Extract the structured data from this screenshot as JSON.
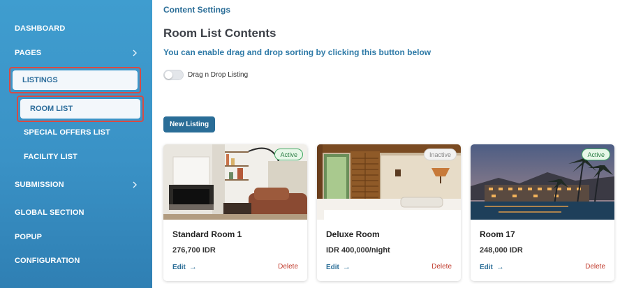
{
  "sidebar": {
    "items": [
      {
        "label": "DASHBOARD"
      },
      {
        "label": "PAGES"
      },
      {
        "label": "LISTINGS"
      },
      {
        "label": "ROOM LIST"
      },
      {
        "label": "SPECIAL OFFERS LIST"
      },
      {
        "label": "FACILITY LIST"
      },
      {
        "label": "SUBMISSION"
      },
      {
        "label": "GLOBAL SECTION"
      },
      {
        "label": "POPUP"
      },
      {
        "label": "CONFIGURATION"
      }
    ],
    "colors": {
      "background": "#3a92c6",
      "highlight_border": "#d64b45"
    }
  },
  "main": {
    "breadcrumb": "Content Settings",
    "title": "Room List Contents",
    "hint": "You can enable drag and drop sorting by clicking this button below",
    "toggle_label": "Drag n Drop Listing",
    "toggle_on": false,
    "new_button": "New Listing",
    "accent": "#2a6d97"
  },
  "cards": [
    {
      "title": "Standard Room 1",
      "price": "276,700 IDR",
      "status": "Active",
      "edit": "Edit",
      "delete": "Delete"
    },
    {
      "title": "Deluxe Room",
      "price": "IDR 400,000/night",
      "status": "Inactive",
      "edit": "Edit",
      "delete": "Delete"
    },
    {
      "title": "Room 17",
      "price": "248,000 IDR",
      "status": "Active",
      "edit": "Edit",
      "delete": "Delete"
    }
  ],
  "icons": {
    "chevron": "chevron-right-icon",
    "edit_arrow": "arrow-right-icon"
  }
}
